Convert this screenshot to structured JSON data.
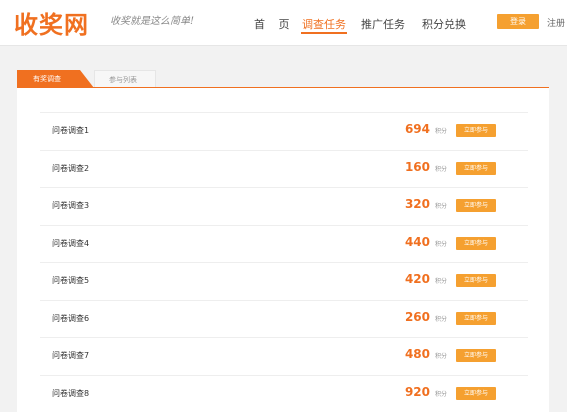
{
  "header": {
    "logo": "收奖网",
    "slogan": "收奖就是这么简单!",
    "nav": {
      "home": "首 页",
      "survey_tasks": "调查任务",
      "promo_tasks": "推广任务",
      "points_exchange": "积分兑换"
    },
    "login": "登录",
    "register": "注册"
  },
  "tabs": {
    "active": "有奖调查",
    "inactive": "参与列表"
  },
  "colors": {
    "accent": "#f07020",
    "button": "#f5a030"
  },
  "surveys": [
    {
      "title": "问卷调查1",
      "points": "694",
      "unit": "积分",
      "action": "立即参与"
    },
    {
      "title": "问卷调查2",
      "points": "160",
      "unit": "积分",
      "action": "立即参与"
    },
    {
      "title": "问卷调查3",
      "points": "320",
      "unit": "积分",
      "action": "立即参与"
    },
    {
      "title": "问卷调查4",
      "points": "440",
      "unit": "积分",
      "action": "立即参与"
    },
    {
      "title": "问卷调查5",
      "points": "420",
      "unit": "积分",
      "action": "立即参与"
    },
    {
      "title": "问卷调查6",
      "points": "260",
      "unit": "积分",
      "action": "立即参与"
    },
    {
      "title": "问卷调查7",
      "points": "480",
      "unit": "积分",
      "action": "立即参与"
    },
    {
      "title": "问卷调查8",
      "points": "920",
      "unit": "积分",
      "action": "立即参与"
    }
  ]
}
